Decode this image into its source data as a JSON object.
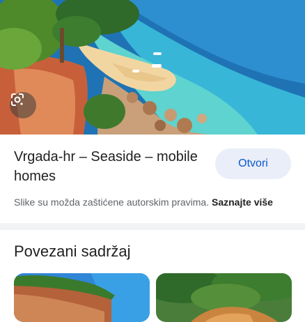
{
  "result": {
    "title": "Vrgada-hr – Seaside – mobile homes",
    "open_label": "Otvori",
    "copyright_text": "Slike su možda zaštićene autorskim pravima.",
    "learn_more_label": "Saznajte više"
  },
  "related": {
    "heading": "Povezani sadržaj"
  },
  "icons": {
    "lens": "google-lens-icon"
  }
}
